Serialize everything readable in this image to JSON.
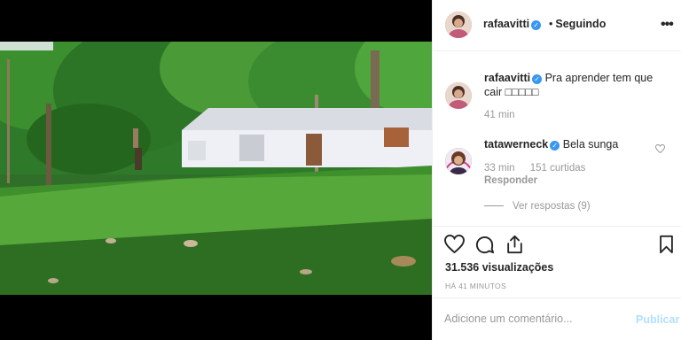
{
  "post": {
    "username": "rafaavitti",
    "separator": "•",
    "follow_status": "Seguindo"
  },
  "caption": {
    "username": "rafaavitti",
    "text": "Pra aprender tem que cair □□□□□",
    "time": "41 min"
  },
  "comment": {
    "username": "tatawerneck",
    "text": "Bela sunga",
    "time": "33 min",
    "likes": "151 curtidas",
    "reply_label": "Responder",
    "view_replies": "Ver respostas (9)"
  },
  "stats": {
    "views": "31.536 visualizações",
    "time_ago": "HÁ 41 MINUTOS"
  },
  "composer": {
    "placeholder": "Adicione um comentário...",
    "publish_label": "Publicar"
  },
  "colors": {
    "verified": "#3897f0",
    "publish_disabled": "#b2dffc",
    "muted_text": "#999999",
    "text": "#262626"
  },
  "icons": [
    "verified-badge-icon",
    "more-options-icon",
    "heart-icon",
    "comment-icon",
    "share-icon",
    "bookmark-icon"
  ]
}
